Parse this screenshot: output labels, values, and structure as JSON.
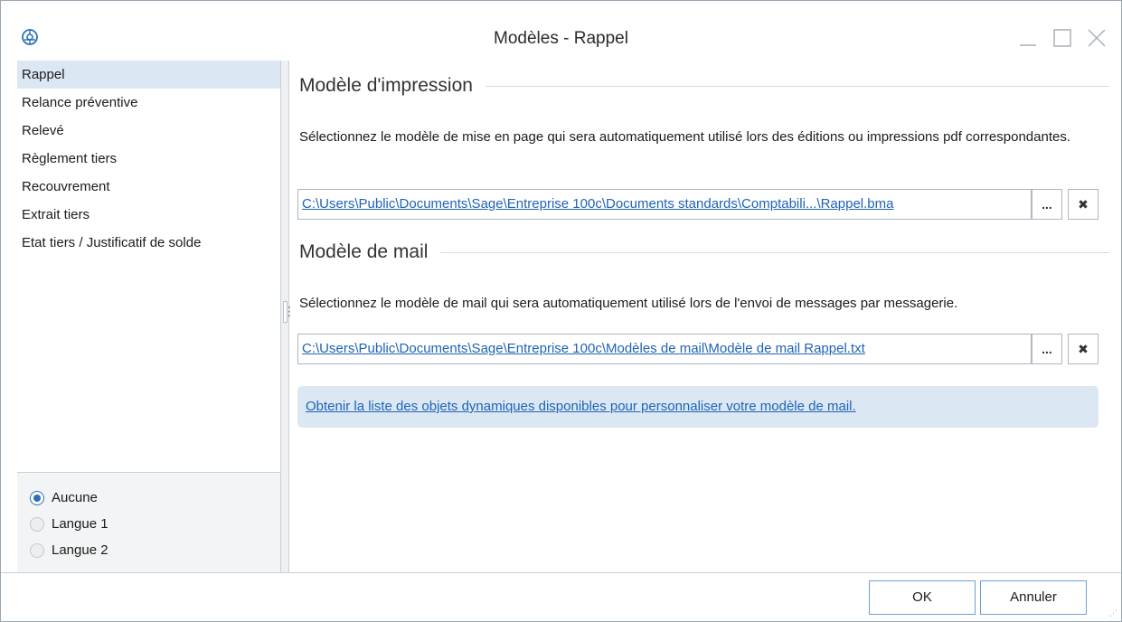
{
  "window": {
    "title": "Modèles - Rappel",
    "logo_icon": "sage-logo-icon",
    "controls": [
      "minimize-icon",
      "maximize-icon",
      "close-icon"
    ]
  },
  "sidebar": {
    "items": [
      {
        "label": "Rappel",
        "selected": true
      },
      {
        "label": "Relance préventive",
        "selected": false
      },
      {
        "label": "Relevé",
        "selected": false
      },
      {
        "label": "Règlement tiers",
        "selected": false
      },
      {
        "label": "Recouvrement",
        "selected": false
      },
      {
        "label": "Extrait tiers",
        "selected": false
      },
      {
        "label": "Etat tiers / Justificatif de solde",
        "selected": false
      }
    ],
    "languages": [
      {
        "label": "Aucune",
        "checked": true
      },
      {
        "label": "Langue 1",
        "checked": false
      },
      {
        "label": "Langue 2",
        "checked": false
      }
    ]
  },
  "print_section": {
    "title": "Modèle d'impression",
    "description": "Sélectionnez le modèle de mise en page qui sera automatiquement utilisé lors des éditions ou impressions pdf correspondantes.",
    "path": "C:\\Users\\Public\\Documents\\Sage\\Entreprise 100c\\Documents standards\\Comptabili...\\Rappel.bma",
    "browse_label": "...",
    "clear_label": "✖"
  },
  "mail_section": {
    "title": "Modèle de mail",
    "description": "Sélectionnez le modèle de mail qui sera automatiquement utilisé lors de l'envoi de messages par messagerie.",
    "path": "C:\\Users\\Public\\Documents\\Sage\\Entreprise 100c\\Modèles de mail\\Modèle de mail Rappel.txt",
    "browse_label": "...",
    "clear_label": "✖",
    "dynamic_objects_link": "Obtenir la liste des objets dynamiques disponibles pour personnaliser votre modèle de mail."
  },
  "footer": {
    "ok_label": "OK",
    "cancel_label": "Annuler"
  },
  "colors": {
    "accent": "#2f6fb7",
    "link": "#1f63b5",
    "selection": "#dbe8f4"
  }
}
